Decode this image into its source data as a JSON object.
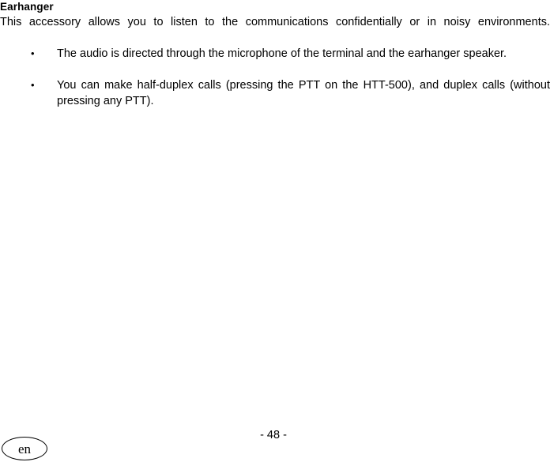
{
  "document": {
    "section": {
      "heading": "Earhanger",
      "intro": "This accessory allows you to listen to the communications confidentially or in noisy environments.",
      "bullets": [
        {
          "marker": "•",
          "text": "The audio is directed through the microphone of the terminal and the earhanger speaker."
        },
        {
          "marker": "•",
          "text": "You can make half-duplex calls (pressing the PTT on the HTT-500), and duplex calls (without pressing any PTT)."
        }
      ]
    },
    "footer": {
      "page_number": "- 48 -",
      "language_badge": "en"
    }
  }
}
